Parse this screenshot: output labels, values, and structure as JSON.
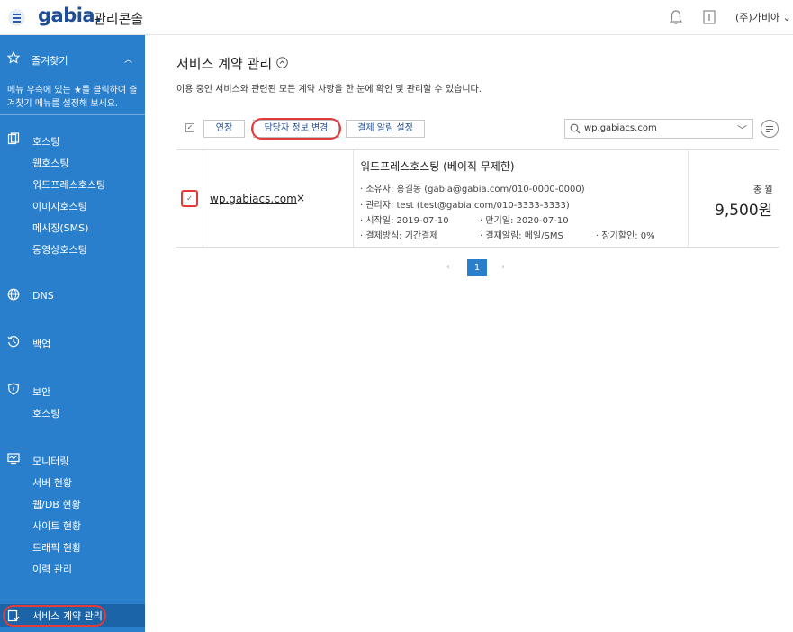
{
  "header": {
    "logo": "gabia.",
    "title": "관리콘솔",
    "account": "(주)가비아"
  },
  "sidebar": {
    "favorites": {
      "label": "즐겨찾기",
      "desc": "메뉴 우측에 있는 ★를 클릭하여 즐겨찾기 메뉴를 설정해 보세요."
    },
    "sections": [
      {
        "label": "호스팅",
        "items": [
          "웹호스팅",
          "워드프레스호스팅",
          "이미지호스팅",
          "메시징(SMS)",
          "동영상호스팅"
        ]
      },
      {
        "label": "DNS",
        "items": []
      },
      {
        "label": "백업",
        "items": []
      },
      {
        "label": "보안",
        "items": [
          "호스팅"
        ]
      },
      {
        "label": "모니터링",
        "items": [
          "서버 현황",
          "웹/DB 현황",
          "사이트 현황",
          "트래픽 현황",
          "이력 관리"
        ]
      }
    ],
    "active": "서비스 계약 관리"
  },
  "main": {
    "title": "서비스 계약 관리",
    "desc": "이용 중인 서비스와 관련된 모든 계약 사항을 한 눈에 확인 및 관리할 수 있습니다.",
    "toolbar": {
      "renew": "연장",
      "contact": "담당자 정보 변경",
      "alert": "결제 알림 설정",
      "search_value": "wp.gabiacs.com"
    },
    "row": {
      "domain": "wp.gabiacs.com",
      "remove": "×",
      "service": "워드프레스호스팅 (베이직 무제한)",
      "owner": "· 소유자: 홍길동 (gabia@gabia.com/010-0000-0000)",
      "admin": "· 관리자: test (test@gabia.com/010-3333-3333)",
      "start": "· 시작일: 2019-07-10",
      "end": "· 만기일: 2020-07-10",
      "payment": "· 결제방식: 기간결제",
      "notice": "· 결재알림: 메일/SMS",
      "discount": "· 장기할인: 0%",
      "total_label": "총 월",
      "total_price": "9,500원"
    },
    "pager": {
      "prev": "‹",
      "current": "1",
      "next": "›"
    }
  },
  "colors": {
    "sidebar": "#2a7fcd",
    "accent": "#1f4e96",
    "highlight": "#e23b3b"
  }
}
